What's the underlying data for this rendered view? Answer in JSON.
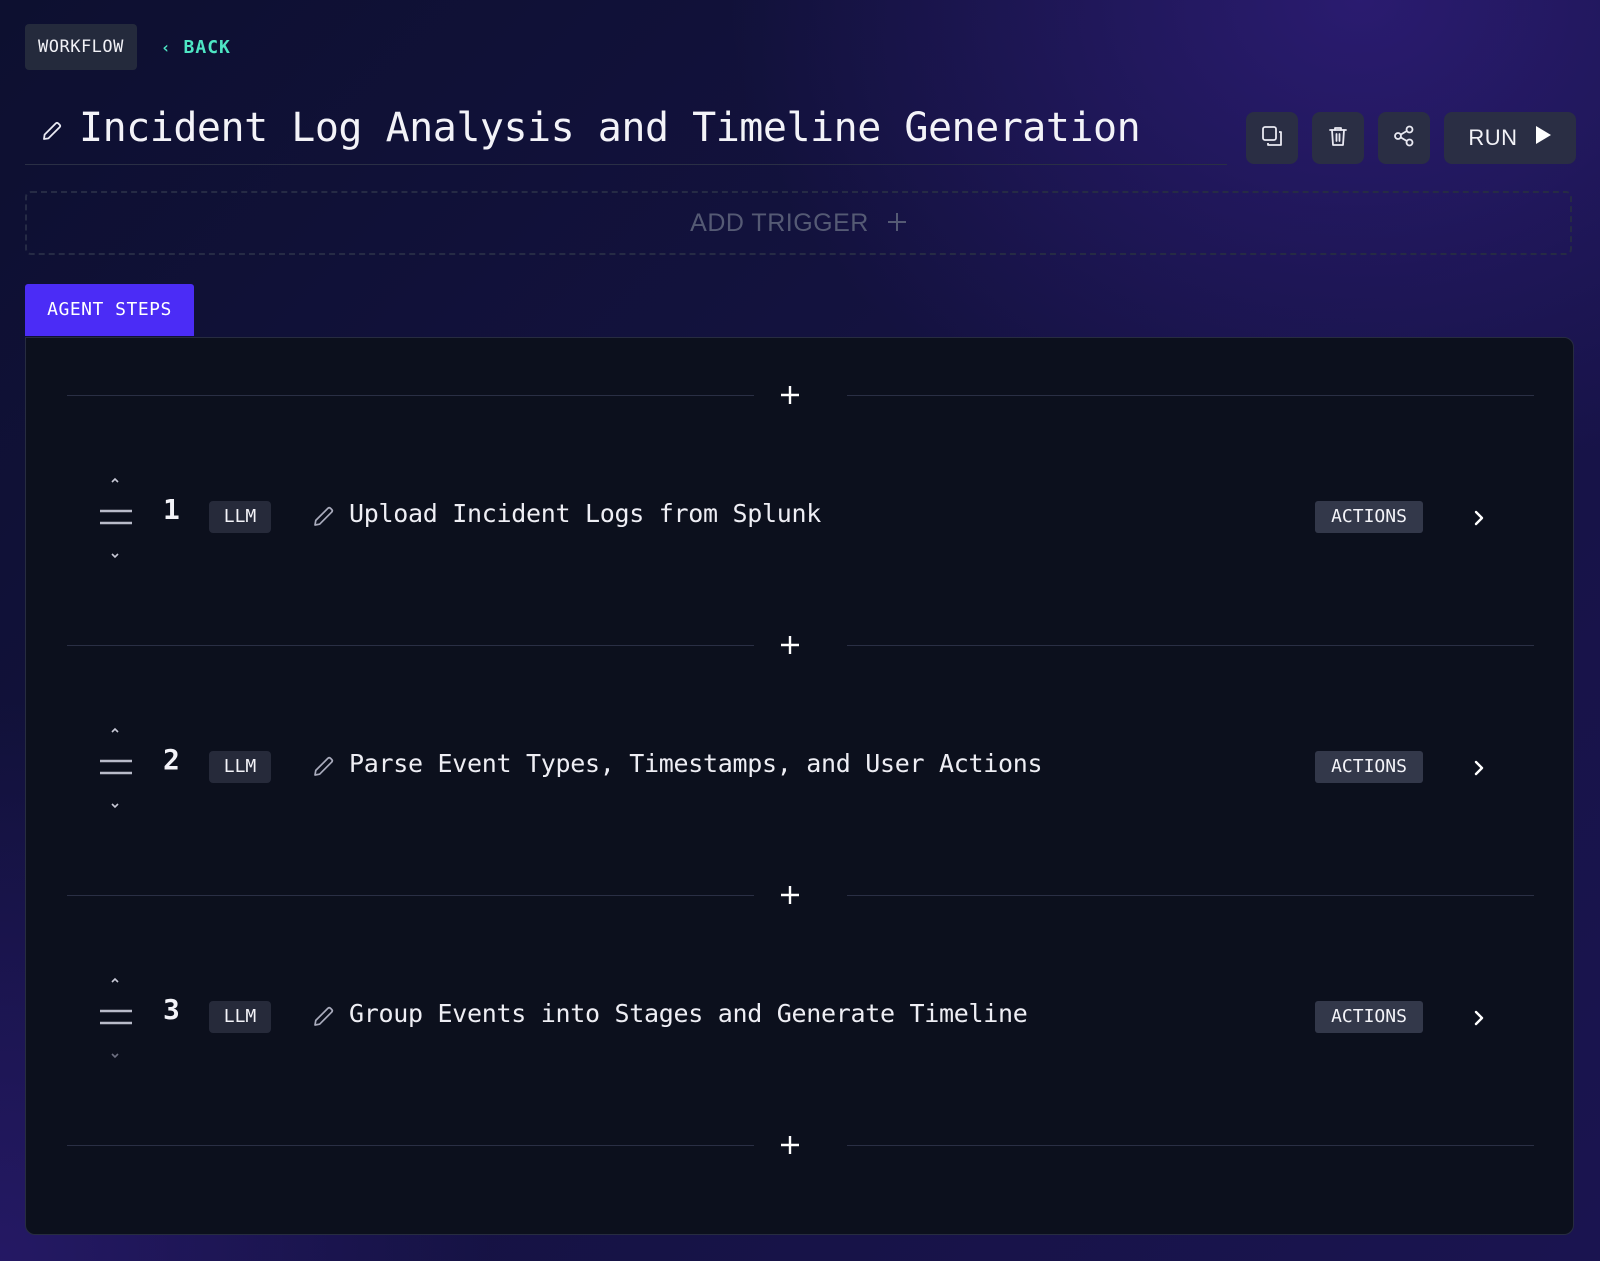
{
  "nav": {
    "workflow_label": "WORKFLOW",
    "back_label": "BACK"
  },
  "workflow": {
    "title": "Incident Log Analysis and Timeline Generation"
  },
  "toolbar": {
    "duplicate_icon": "copy-icon",
    "delete_icon": "trash-icon",
    "share_icon": "share-icon",
    "run_label": "RUN",
    "run_icon": "play-icon"
  },
  "trigger": {
    "add_label": "ADD TRIGGER",
    "icon": "plus-icon"
  },
  "tabs": {
    "active_label": "AGENT STEPS",
    "active_color": "#4b2cf6"
  },
  "steps": [
    {
      "number": "1",
      "type": "LLM",
      "name": "Upload Incident Logs from Splunk",
      "actions_label": "ACTIONS"
    },
    {
      "number": "2",
      "type": "LLM",
      "name": "Parse Event Types, Timestamps, and User Actions",
      "actions_label": "ACTIONS"
    },
    {
      "number": "3",
      "type": "LLM",
      "name": "Group Events into Stages and Generate Timeline",
      "actions_label": "ACTIONS"
    }
  ],
  "colors": {
    "accent_back": "#4ee6c4",
    "panel_bg": "#0c101d",
    "button_bg": "#2a2e44"
  }
}
